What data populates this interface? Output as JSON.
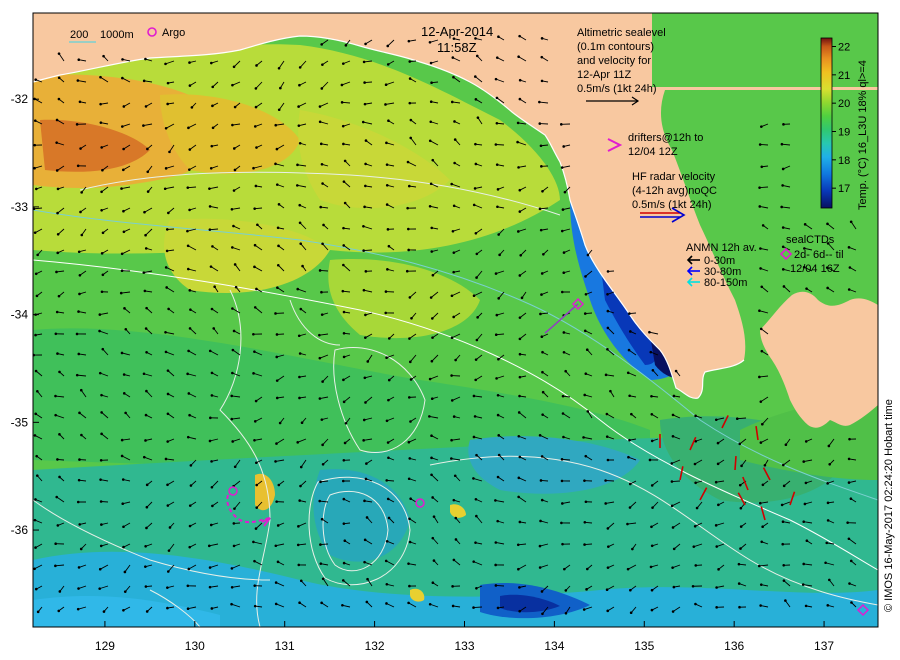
{
  "map": {
    "date": "12-Apr-2014",
    "time": "11:58Z",
    "lon_ticks": [
      "129",
      "130",
      "131",
      "132",
      "133",
      "134",
      "135",
      "136",
      "137"
    ],
    "lat_ticks": [
      "-32",
      "-33",
      "-34",
      "-35",
      "-36"
    ],
    "lon_range": [
      128.2,
      137.6
    ],
    "lat_range": [
      -31.2,
      -36.9
    ]
  },
  "legend": {
    "bathymetry": {
      "label_200": "200",
      "label_1000": "1000m",
      "color_200": "#7ad0d0",
      "color_1000": "#ffffff"
    },
    "argo": {
      "label": "Argo",
      "color": "#e01cd0"
    },
    "altimetry": {
      "lines": [
        "Altimetric sealevel",
        "(0.1m contours)",
        "and velocity for",
        "12-Apr 11Z",
        "0.5m/s (1kt 24h)"
      ]
    },
    "drifters": {
      "lines": [
        "drifters@12h to",
        "12/04 12Z"
      ],
      "color": "#e01cd0"
    },
    "hf_radar": {
      "lines": [
        "HF radar velocity",
        "(4-12h avg)noQC",
        "0.5m/s (1kt 24h)"
      ],
      "colors": [
        "#d00000",
        "#0000d0"
      ]
    },
    "anmn": {
      "title": "ANMN 12h av.",
      "items": [
        {
          "label": "0-30m",
          "color": "#000000"
        },
        {
          "label": "30-80m",
          "color": "#0000ff"
        },
        {
          "label": "80-150m",
          "color": "#00e0e0"
        }
      ]
    },
    "seal_ctds": {
      "lines": [
        "sealCTDs",
        "2d- 6d-- til",
        "12/04 16Z"
      ],
      "color": "#e01cd0"
    }
  },
  "colorbar": {
    "ticks": [
      "22",
      "21",
      "20",
      "19",
      "18",
      "17"
    ],
    "title": "Temp. (°C) 16_L3U 18% ql>=4",
    "min": 16.3,
    "max": 22.3
  },
  "credit": "© IMOS 16-May-2017 02:24:20 Hobart time",
  "colors": {
    "land": "#f8c8a0",
    "sst_scale": [
      "#081060",
      "#0838b8",
      "#1078e0",
      "#20b0e8",
      "#28c8b0",
      "#30c870",
      "#50d040",
      "#90d830",
      "#d8e030",
      "#f0c020",
      "#e89020",
      "#c85818",
      "#701010"
    ]
  }
}
